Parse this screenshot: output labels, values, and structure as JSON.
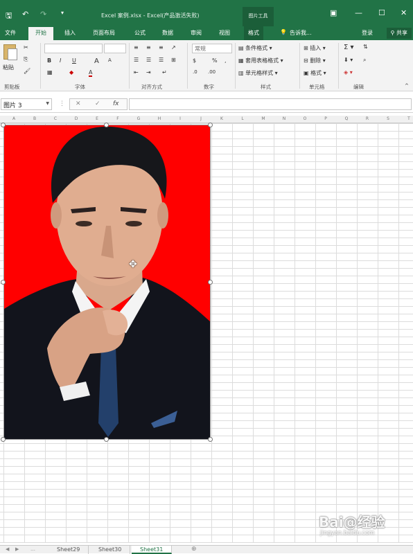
{
  "window": {
    "title": "Excel 案例.xlsx - Excel(产品激活失败)",
    "context_tool": "图片工具",
    "accent": "#217346"
  },
  "ribbon_tabs": [
    "文件",
    "开始",
    "插入",
    "页面布局",
    "公式",
    "数据",
    "审阅",
    "视图",
    "格式"
  ],
  "tell_me": "告诉我...",
  "signin": "登录",
  "share": "共享",
  "ribbon": {
    "clipboard": {
      "paste": "粘贴",
      "label": "剪贴板"
    },
    "font": {
      "label": "字体",
      "bold": "B",
      "italic": "I",
      "underline": "U",
      "grow": "A",
      "shrink": "A"
    },
    "alignment": {
      "label": "对齐方式"
    },
    "number": {
      "label": "数字",
      "format": "常规",
      "percent": "%",
      "comma": ","
    },
    "styles": {
      "label": "样式",
      "conditional": "条件格式",
      "table": "套用表格格式",
      "cell": "单元格样式"
    },
    "cells": {
      "label": "单元格",
      "insert": "插入",
      "delete": "删除",
      "format": "格式"
    },
    "editing": {
      "label": "编辑"
    }
  },
  "formula_bar": {
    "name_box": "图片 3",
    "cancel": "✕",
    "enter": "✓",
    "fx": "fx",
    "value": ""
  },
  "columns": [
    "A",
    "B",
    "C",
    "D",
    "E",
    "F",
    "G",
    "H",
    "I",
    "J",
    "K",
    "L",
    "M",
    "N",
    "O",
    "P",
    "Q",
    "R",
    "S",
    "T"
  ],
  "picture": {
    "name": "图片 3",
    "background_color": "#ff0000"
  },
  "sheets": {
    "tabs": [
      "Sheet29",
      "Sheet30",
      "Sheet31"
    ],
    "active": "Sheet31",
    "add": "⊕"
  },
  "watermark": {
    "main": "Bai@经验",
    "sub": "jingyan.baidu.com"
  }
}
